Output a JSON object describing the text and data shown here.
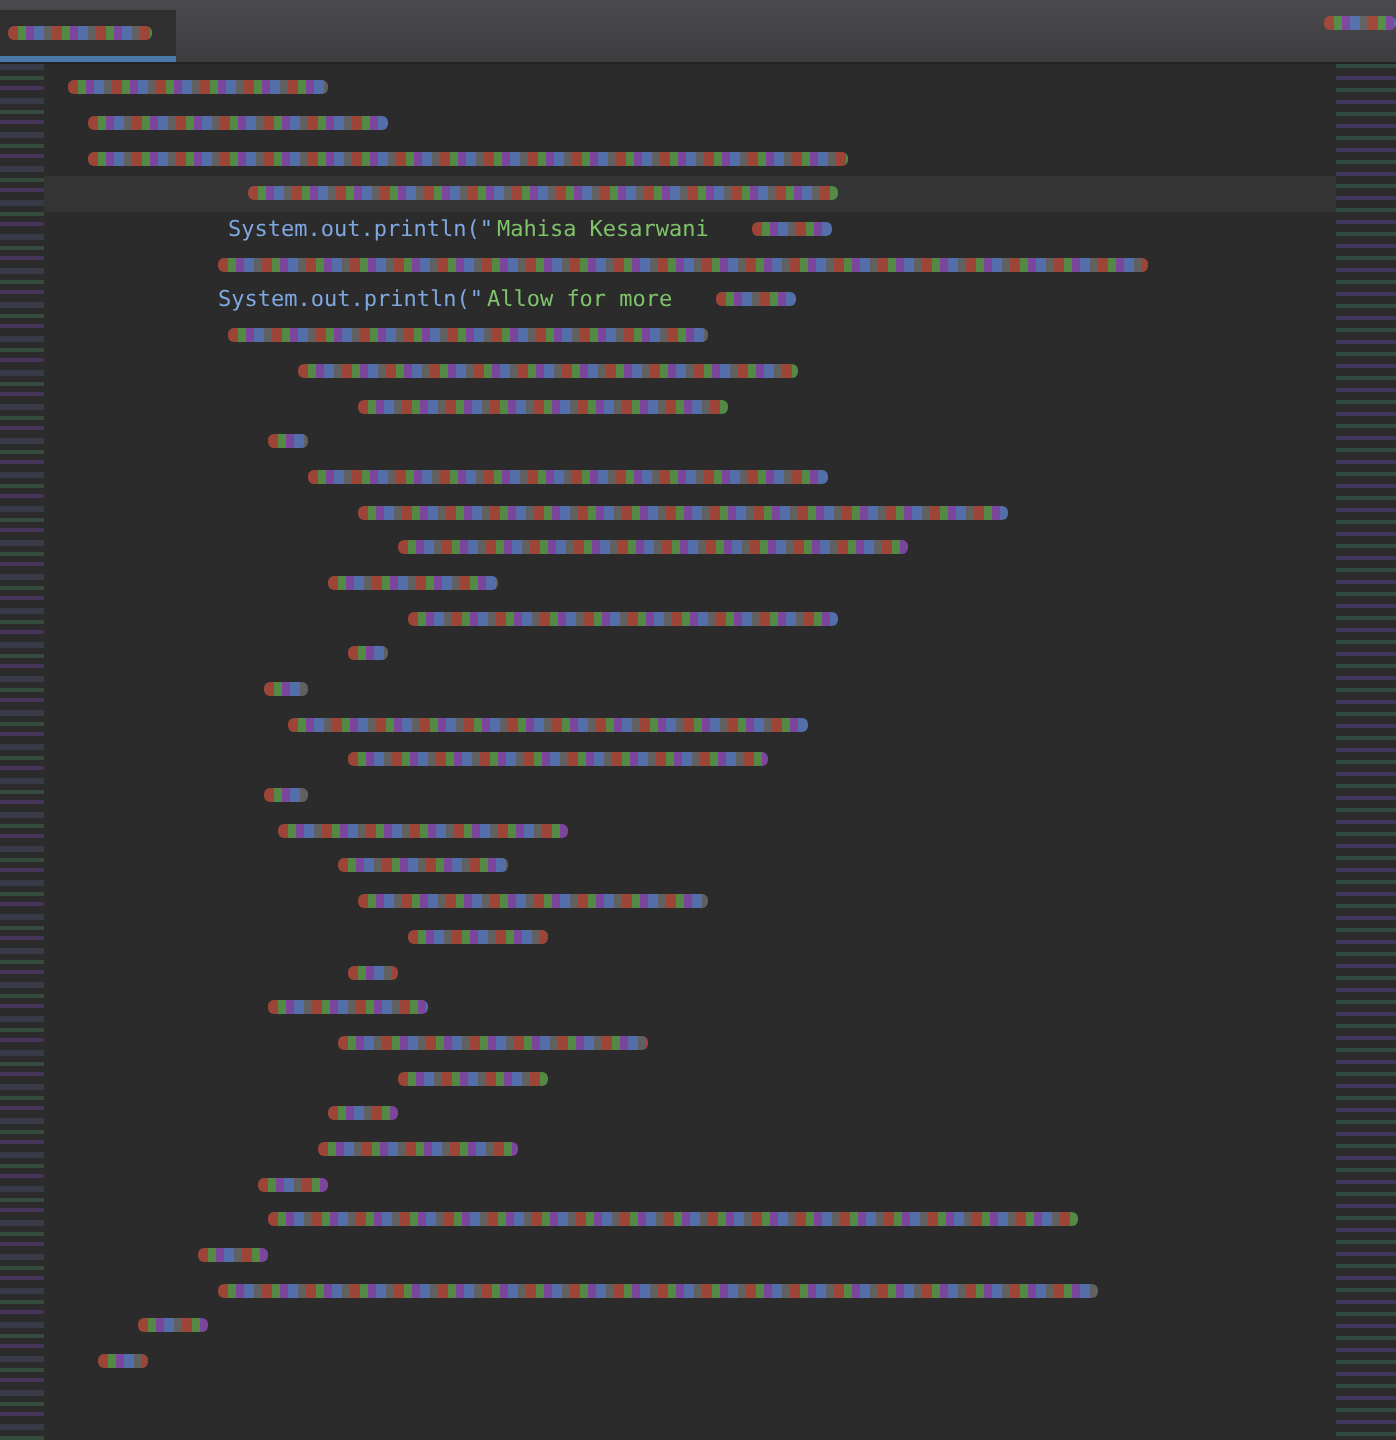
{
  "editor": {
    "lines": [
      {
        "kind": "blurred",
        "highlighted": false
      },
      {
        "kind": "blurred",
        "highlighted": false
      },
      {
        "kind": "blurred",
        "highlighted": false
      },
      {
        "kind": "blurred",
        "highlighted": true
      },
      {
        "kind": "code",
        "highlighted": false,
        "tokens": [
          {
            "kind": "call",
            "text": "System.out.println(\""
          },
          {
            "kind": "string",
            "text": "Mahisa Kesarwani"
          }
        ]
      },
      {
        "kind": "blurred",
        "highlighted": false
      },
      {
        "kind": "code",
        "highlighted": false,
        "tokens": [
          {
            "kind": "call",
            "text": "System.out.println(\""
          },
          {
            "kind": "string",
            "text": "Allow for more"
          }
        ]
      },
      {
        "kind": "blurred",
        "highlighted": false
      },
      {
        "kind": "blurred",
        "highlighted": false
      },
      {
        "kind": "blurred",
        "highlighted": false
      },
      {
        "kind": "blurred",
        "highlighted": false
      },
      {
        "kind": "blurred",
        "highlighted": false
      },
      {
        "kind": "blurred",
        "highlighted": false
      },
      {
        "kind": "blurred",
        "highlighted": false
      },
      {
        "kind": "blurred",
        "highlighted": false
      },
      {
        "kind": "blurred",
        "highlighted": false
      },
      {
        "kind": "blurred",
        "highlighted": false
      },
      {
        "kind": "blurred",
        "highlighted": false
      },
      {
        "kind": "blurred",
        "highlighted": false
      },
      {
        "kind": "blurred",
        "highlighted": false
      },
      {
        "kind": "blurred",
        "highlighted": false
      },
      {
        "kind": "blurred",
        "highlighted": false
      },
      {
        "kind": "blurred",
        "highlighted": false
      },
      {
        "kind": "blurred",
        "highlighted": false
      },
      {
        "kind": "blurred",
        "highlighted": false
      },
      {
        "kind": "blurred",
        "highlighted": false
      },
      {
        "kind": "blurred",
        "highlighted": false
      },
      {
        "kind": "blurred",
        "highlighted": false
      },
      {
        "kind": "blurred",
        "highlighted": false
      },
      {
        "kind": "blurred",
        "highlighted": false
      },
      {
        "kind": "blurred",
        "highlighted": false
      },
      {
        "kind": "blurred",
        "highlighted": false
      },
      {
        "kind": "blurred",
        "highlighted": false
      },
      {
        "kind": "blurred",
        "highlighted": false
      },
      {
        "kind": "blurred",
        "highlighted": false
      },
      {
        "kind": "blurred",
        "highlighted": false
      },
      {
        "kind": "blurred",
        "highlighted": false
      }
    ]
  }
}
